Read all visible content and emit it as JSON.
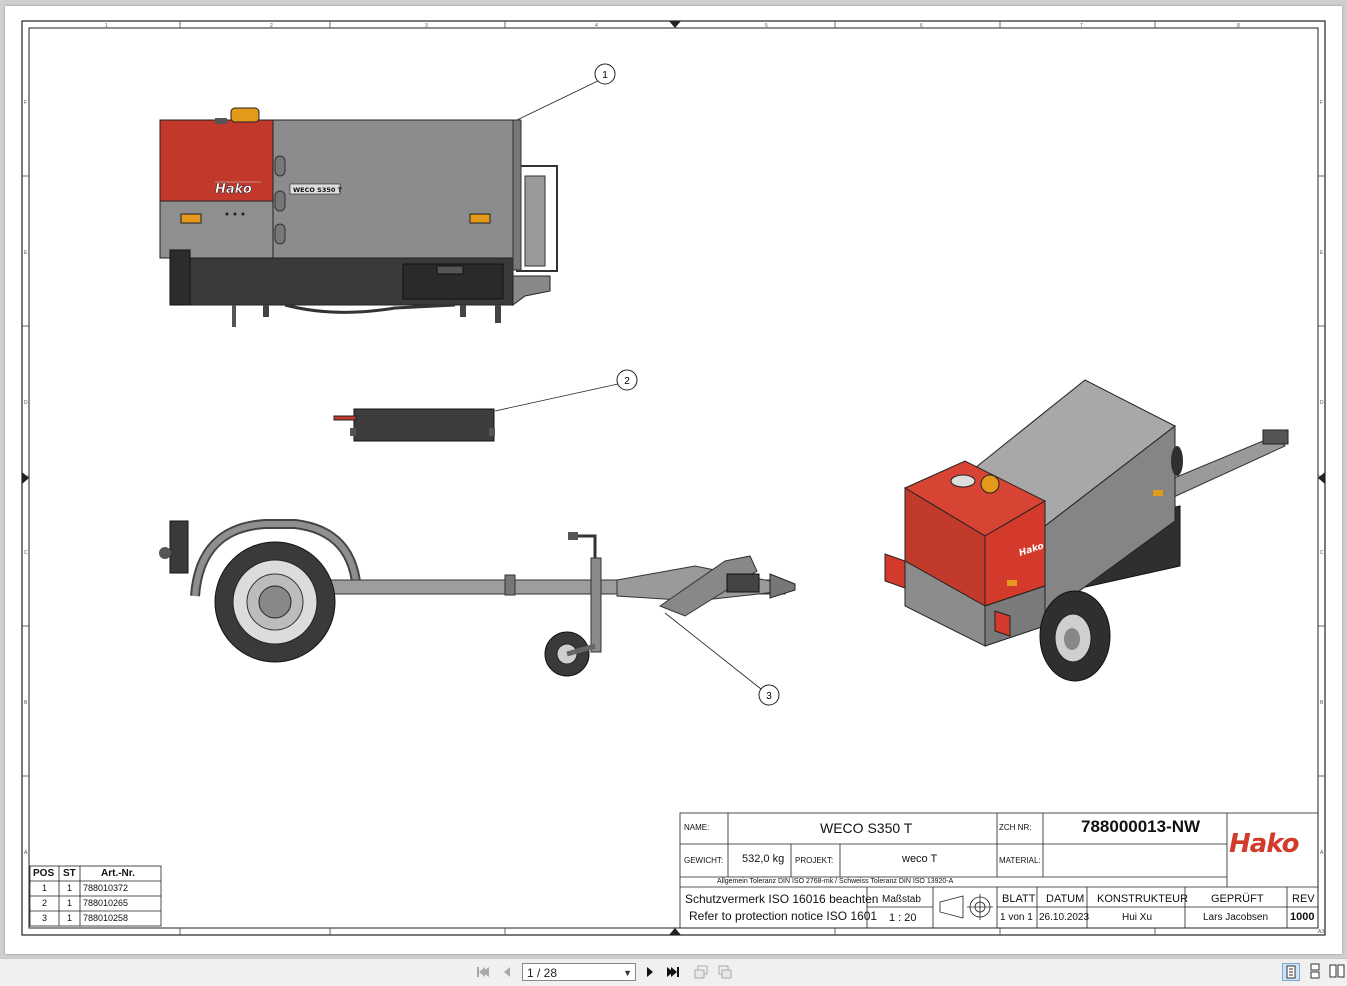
{
  "title_block": {
    "name_label": "NAME:",
    "name_value": "WECO S350 T",
    "zch_label": "ZCH NR:",
    "zch_value": "788000013-NW",
    "weight_label": "GEWICHT:",
    "weight_value": "532,0 kg",
    "project_label": "PROJEKT:",
    "project_value": "weco T",
    "material_label": "MATERIAL:",
    "material_value": "",
    "tolerance_note": "Allgemein Toleranz DIN ISO 2768-mk / Schweiss Toleranz DIN ISO 13920-A",
    "protection_de": "Schutzvermerk  ISO 16016 beachten",
    "protection_en": "Refer to protection notice ISO 1601",
    "scale_label": "Maßstab",
    "scale_value": "1 : 20",
    "sheet_label": "BLATT",
    "sheet_value": "1 von 1",
    "date_label": "DATUM",
    "date_value": "26.10.2023",
    "designer_label": "KONSTRUKTEUR",
    "designer_value": "Hui Xu",
    "checked_label": "GEPRÜFT",
    "checked_value": "Lars Jacobsen",
    "rev_label": "REV",
    "rev_value": "1000",
    "logo_text": "Hako"
  },
  "parts_list": {
    "headers": [
      "POS",
      "ST",
      "Art.-Nr."
    ],
    "rows": [
      {
        "pos": "1",
        "st": "1",
        "art": "788010372"
      },
      {
        "pos": "2",
        "st": "1",
        "art": "788010265"
      },
      {
        "pos": "3",
        "st": "1",
        "art": "788010258"
      }
    ]
  },
  "balloons": [
    "1",
    "2",
    "3"
  ],
  "machine_labels": {
    "brand": "Hako",
    "model_badge": "WECO S350 T"
  },
  "border_marks": {
    "top_numbers": [
      "1",
      "2",
      "3",
      "4",
      "5",
      "6",
      "7",
      "8"
    ],
    "side_letters": [
      "F",
      "E",
      "D",
      "C",
      "B",
      "A"
    ],
    "corner": "A3"
  },
  "viewer": {
    "page_indicator": "1 / 28",
    "icons": [
      "first-page-icon",
      "previous-page-icon",
      "next-page-icon",
      "last-page-icon",
      "back-view-icon",
      "forward-view-icon",
      "single-page-icon",
      "continuous-icon",
      "facing-pages-icon"
    ]
  },
  "colors": {
    "hako_red": "#d43a2c",
    "body_grey": "#8f8f8f",
    "chassis_dark": "#3a3a3a",
    "beacon_orange": "#e39a1a"
  }
}
